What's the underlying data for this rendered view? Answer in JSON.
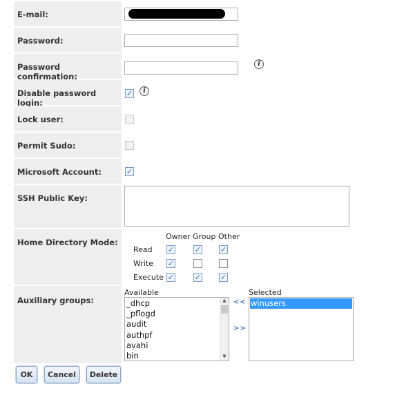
{
  "form": {
    "email_label": "E-mail:",
    "password_label": "Password:",
    "password_confirm_label": "Password confirmation:",
    "disable_password_label": "Disable password login:",
    "lock_user_label": "Lock user:",
    "permit_sudo_label": "Permit Sudo:",
    "microsoft_account_label": "Microsoft Account:",
    "ssh_key_label": "SSH Public Key:",
    "home_dir_mode_label": "Home Directory Mode:",
    "aux_groups_label": "Auxiliary groups:",
    "info_glyph": "i",
    "check_glyph": "✓",
    "disable_password_checked": true,
    "lock_user_checked": false,
    "permit_sudo_checked": false,
    "microsoft_account_checked": true
  },
  "mode": {
    "columns": [
      "Owner",
      "Group",
      "Other"
    ],
    "rows": [
      {
        "label": "Read",
        "values": [
          true,
          true,
          true
        ]
      },
      {
        "label": "Write",
        "values": [
          true,
          false,
          false
        ]
      },
      {
        "label": "Execute",
        "values": [
          true,
          true,
          true
        ]
      }
    ]
  },
  "groups": {
    "available_label": "Available",
    "selected_label": "Selected",
    "available": [
      "_dhcp",
      "_pflogd",
      "audit",
      "authpf",
      "avahi",
      "bin"
    ],
    "selected": [
      "winusers"
    ],
    "move_left": "<<",
    "move_right": ">>"
  },
  "buttons": {
    "ok": "OK",
    "cancel": "Cancel",
    "delete": "Delete"
  }
}
